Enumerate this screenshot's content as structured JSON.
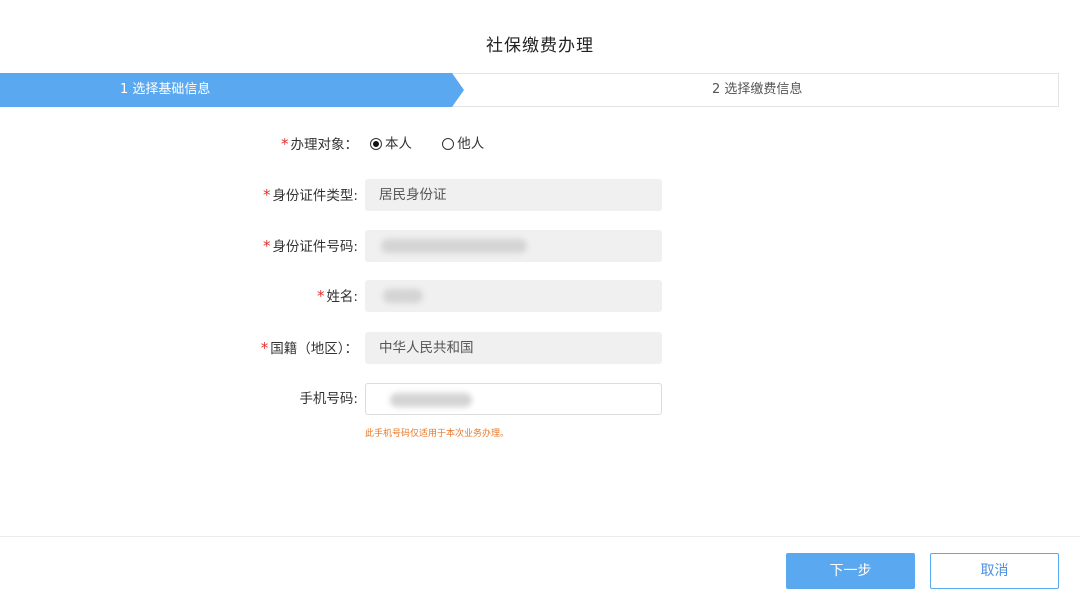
{
  "page": {
    "title": "社保缴费办理"
  },
  "steps": [
    {
      "label": "1 选择基础信息",
      "active": true
    },
    {
      "label": "2 选择缴费信息",
      "active": false
    }
  ],
  "form": {
    "subject": {
      "label": "办理对象：",
      "required": true,
      "options": [
        {
          "label": "本人",
          "selected": true
        },
        {
          "label": "他人",
          "selected": false
        }
      ]
    },
    "id_type": {
      "label": "身份证件类型:",
      "required": true,
      "value": "居民身份证"
    },
    "id_number": {
      "label": "身份证件号码:",
      "required": true,
      "value": ""
    },
    "name": {
      "label": "姓名:",
      "required": true,
      "value": ""
    },
    "nationality": {
      "label": "国籍（地区）：",
      "required": true,
      "value": "中华人民共和国"
    },
    "phone": {
      "label": "手机号码:",
      "required": false,
      "value": ""
    },
    "phone_hint": "此手机号码仅适用于本次业务办理。"
  },
  "actions": {
    "next_label": "下一步",
    "cancel_label": "取消"
  },
  "colors": {
    "accent": "#5aa8f0",
    "required": "#e0312f",
    "hint": "#e8782a"
  }
}
